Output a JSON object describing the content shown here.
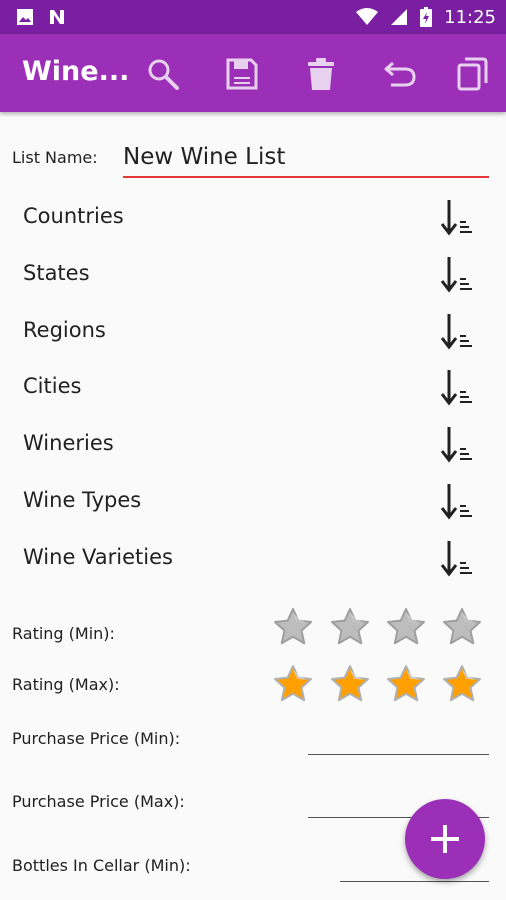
{
  "status_bar": {
    "time": "11:25"
  },
  "app_bar": {
    "title": "Wine...",
    "actions": [
      "search-icon",
      "save-icon",
      "delete-icon",
      "undo-icon",
      "copy-icon"
    ]
  },
  "list_name": {
    "label": "List Name:",
    "value": "New Wine List"
  },
  "sort_items": [
    {
      "label": "Countries"
    },
    {
      "label": "States"
    },
    {
      "label": "Regions"
    },
    {
      "label": "Cities"
    },
    {
      "label": "Wineries"
    },
    {
      "label": "Wine Types"
    },
    {
      "label": "Wine Varieties"
    }
  ],
  "rating_min": {
    "label": "Rating (Min):",
    "filled_stars": 0,
    "total_stars": 4
  },
  "rating_max": {
    "label": "Rating (Max):",
    "filled_stars": 4,
    "total_stars": 4
  },
  "purchase_price_min": {
    "label": "Purchase Price (Min):",
    "value": ""
  },
  "purchase_price_max": {
    "label": "Purchase Price (Max):",
    "value": ""
  },
  "bottles_in_cellar_min": {
    "label": "Bottles In Cellar (Min):",
    "value": ""
  },
  "colors": {
    "primary": "#9c2fb8",
    "status_bar": "#7b1fa2",
    "error_underline": "#e53935",
    "star_filled": "#ffa000",
    "star_empty": "#bdbdbd"
  },
  "fab": {
    "icon": "plus-icon"
  }
}
